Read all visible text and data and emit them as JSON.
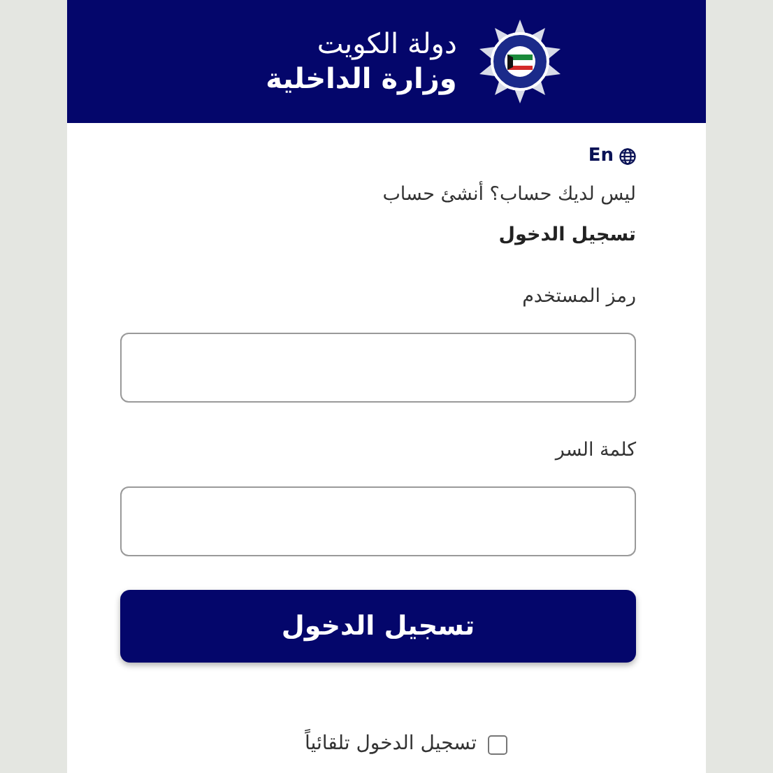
{
  "header": {
    "line_1": "دولة الكويت",
    "line_2": "وزارة الداخلية"
  },
  "language_link": "En",
  "signup_prompt": "ليس لديك حساب؟ أنشئ حساب",
  "form_title": "تسجيل الدخول",
  "fields": [
    {
      "label": "رمز المستخدم"
    },
    {
      "label": "كلمة السر"
    }
  ],
  "submit_button": "تسجيل الدخول",
  "remember_me": {
    "label": "تسجيل الدخول تلقائياً",
    "checked": false
  }
}
